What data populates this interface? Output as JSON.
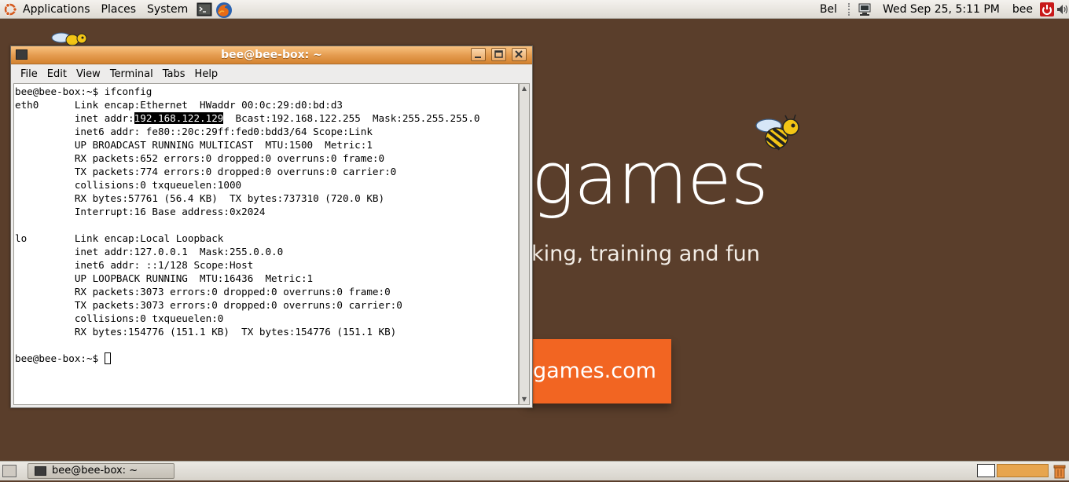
{
  "top_panel": {
    "menus": [
      "Applications",
      "Places",
      "System"
    ],
    "keyboard_layout": "Bel",
    "clock": "Wed Sep 25,  5:11 PM",
    "user": "bee"
  },
  "wallpaper": {
    "headline": "games",
    "tagline": "king, training and fun",
    "button": "games.com",
    "colors": {
      "background": "#5a3e2b",
      "accent": "#f26522"
    }
  },
  "terminal": {
    "title": "bee@bee-box: ~",
    "menus": {
      "file": "File",
      "edit": "Edit",
      "view": "View",
      "terminal": "Terminal",
      "tabs": "Tabs",
      "help": "Help"
    },
    "lines": {
      "l01": "bee@bee-box:~$ ifconfig",
      "l02": "eth0      Link encap:Ethernet  HWaddr 00:0c:29:d0:bd:d3",
      "l03_pre": "          inet addr:",
      "l03_sel": "192.168.122.129",
      "l03_post": "  Bcast:192.168.122.255  Mask:255.255.255.0",
      "l04": "          inet6 addr: fe80::20c:29ff:fed0:bdd3/64 Scope:Link",
      "l05": "          UP BROADCAST RUNNING MULTICAST  MTU:1500  Metric:1",
      "l06": "          RX packets:652 errors:0 dropped:0 overruns:0 frame:0",
      "l07": "          TX packets:774 errors:0 dropped:0 overruns:0 carrier:0",
      "l08": "          collisions:0 txqueuelen:1000",
      "l09": "          RX bytes:57761 (56.4 KB)  TX bytes:737310 (720.0 KB)",
      "l10": "          Interrupt:16 Base address:0x2024",
      "l11": "",
      "l12": "lo        Link encap:Local Loopback",
      "l13": "          inet addr:127.0.0.1  Mask:255.0.0.0",
      "l14": "          inet6 addr: ::1/128 Scope:Host",
      "l15": "          UP LOOPBACK RUNNING  MTU:16436  Metric:1",
      "l16": "          RX packets:3073 errors:0 dropped:0 overruns:0 frame:0",
      "l17": "          TX packets:3073 errors:0 dropped:0 overruns:0 carrier:0",
      "l18": "          collisions:0 txqueuelen:0",
      "l19": "          RX bytes:154776 (151.1 KB)  TX bytes:154776 (151.1 KB)",
      "l20": "",
      "l21": "bee@bee-box:~$ "
    }
  },
  "bottom_panel": {
    "task_label": "bee@bee-box: ~"
  },
  "icons": {
    "logo": "ubuntu-logo-icon",
    "launcher_terminal": "terminal-icon",
    "launcher_browser": "firefox-icon",
    "network": "network-icon",
    "power": "power-icon",
    "volume": "volume-icon",
    "trash": "trash-icon"
  }
}
